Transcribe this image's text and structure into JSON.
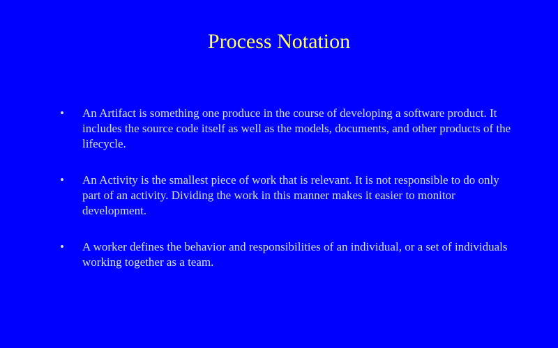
{
  "slide": {
    "title": "Process Notation",
    "bullet_symbol": "•",
    "bullets": [
      "An Artifact is something one produce in the course of developing a software product. It includes the source code itself as well as the models, documents, and other products of the lifecycle.",
      "An Activity is the smallest piece of work that is relevant. It is not responsible to do only part of an activity. Dividing the work in this manner makes it easier to monitor development.",
      "A worker defines the behavior and responsibilities of an individual, or a set of individuals working together as a team."
    ]
  },
  "colors": {
    "background": "#0000FF",
    "title": "#FFFF66",
    "body_text": "#D4E0FF"
  }
}
